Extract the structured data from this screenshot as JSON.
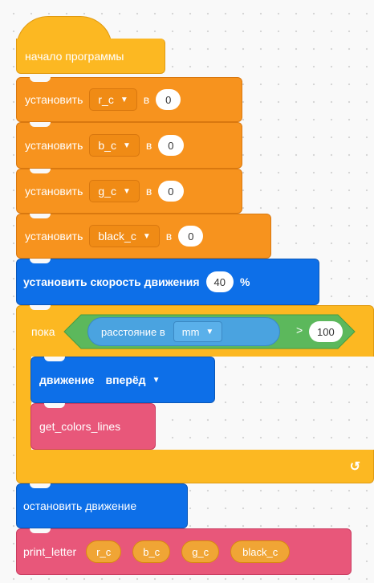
{
  "start": {
    "label": "начало программы"
  },
  "set_blocks": [
    {
      "label": "установить",
      "var": "r_c",
      "to": "в",
      "value": "0"
    },
    {
      "label": "установить",
      "var": "b_c",
      "to": "в",
      "value": "0"
    },
    {
      "label": "установить",
      "var": "g_c",
      "to": "в",
      "value": "0"
    },
    {
      "label": "установить",
      "var": "black_c",
      "to": "в",
      "value": "0"
    }
  ],
  "speed": {
    "label": "установить скорость движения",
    "value": "40",
    "unit": "%"
  },
  "loop": {
    "label": "пока",
    "sensor_label": "расстояние в",
    "unit": "mm",
    "op": ">",
    "value": "100"
  },
  "move": {
    "label": "движение",
    "direction": "вперёд"
  },
  "get_colors": {
    "label": "get_colors_lines"
  },
  "stop": {
    "label": "остановить движение"
  },
  "print": {
    "label": "print_letter",
    "args": [
      "r_c",
      "b_c",
      "g_c",
      "black_c"
    ]
  },
  "icons": {
    "dropdown": "▼",
    "loop_arrow": "↺"
  },
  "colors": {
    "orange": "#f7931e",
    "yellow": "#fcb822",
    "blue": "#0d6fe8",
    "pink": "#e8577a",
    "green": "#5cb85c"
  }
}
